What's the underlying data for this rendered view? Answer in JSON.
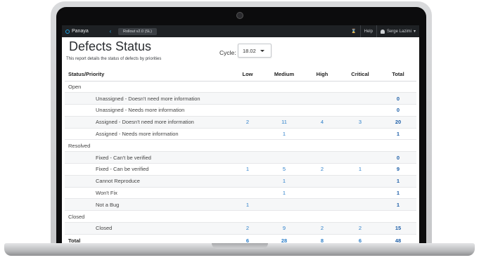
{
  "topbar": {
    "brand": "Panaya",
    "back_icon": "chevron-left-icon",
    "tab_label": "Rollout v2.0 (SL)",
    "help_label": "Help",
    "user_name": "Serge Lazimi"
  },
  "report": {
    "title": "Defects Status",
    "subtitle": "This report details the status of defects by priorities",
    "cycle_label": "Cycle:",
    "cycle_value": "18.02"
  },
  "table": {
    "headers": [
      "Status/Priority",
      "Low",
      "Medium",
      "High",
      "Critical",
      "Total"
    ],
    "groups": [
      {
        "name": "Open",
        "rows": [
          {
            "label": "Unassigned - Doesn't need more information",
            "low": "",
            "medium": "",
            "high": "",
            "critical": "",
            "total": "0"
          },
          {
            "label": "Unassigned - Needs more information",
            "low": "",
            "medium": "",
            "high": "",
            "critical": "",
            "total": "0"
          },
          {
            "label": "Assigned - Doesn't need more information",
            "low": "2",
            "medium": "11",
            "high": "4",
            "critical": "3",
            "total": "20"
          },
          {
            "label": "Assigned - Needs more information",
            "low": "",
            "medium": "1",
            "high": "",
            "critical": "",
            "total": "1"
          }
        ]
      },
      {
        "name": "Resolved",
        "rows": [
          {
            "label": "Fixed - Can't be verified",
            "low": "",
            "medium": "",
            "high": "",
            "critical": "",
            "total": "0"
          },
          {
            "label": "Fixed - Can be verified",
            "low": "1",
            "medium": "5",
            "high": "2",
            "critical": "1",
            "total": "9"
          },
          {
            "label": "Cannot Reproduce",
            "low": "",
            "medium": "1",
            "high": "",
            "critical": "",
            "total": "1"
          },
          {
            "label": "Won't Fix",
            "low": "",
            "medium": "1",
            "high": "",
            "critical": "",
            "total": "1"
          },
          {
            "label": "Not a Bug",
            "low": "1",
            "medium": "",
            "high": "",
            "critical": "",
            "total": "1"
          }
        ]
      },
      {
        "name": "Closed",
        "rows": [
          {
            "label": "Closed",
            "low": "2",
            "medium": "9",
            "high": "2",
            "critical": "2",
            "total": "15"
          }
        ]
      }
    ],
    "total_row": {
      "label": "Total",
      "low": "6",
      "medium": "28",
      "high": "8",
      "critical": "6",
      "total": "48"
    }
  }
}
